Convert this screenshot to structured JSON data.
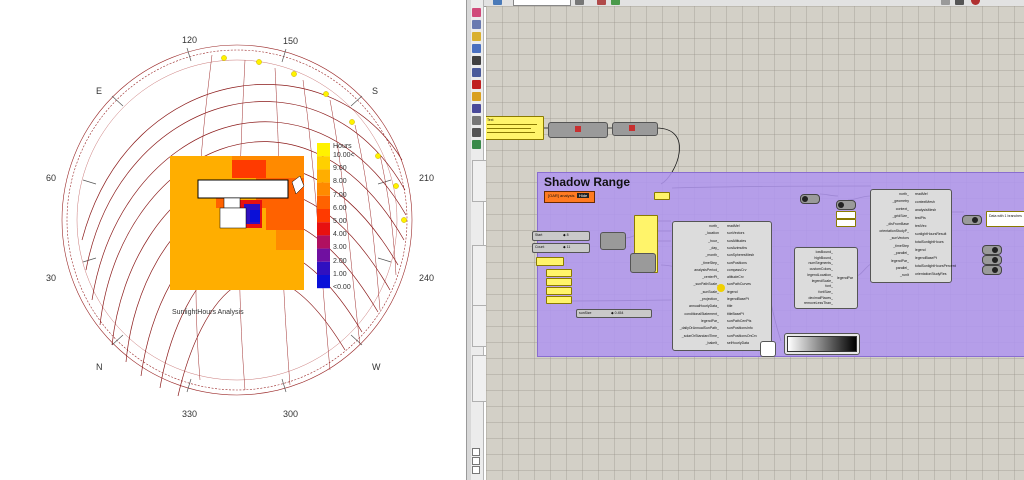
{
  "viewport": {
    "compass": {
      "e": "E",
      "s": "S",
      "n": "N",
      "w": "W",
      "deg_120": "120",
      "deg_150": "150",
      "deg_60": "60",
      "deg_210": "210",
      "deg_30": "30",
      "deg_240": "240",
      "deg_330": "330",
      "deg_300": "300"
    },
    "legend": {
      "title": "Hours",
      "labels": [
        "10.00<",
        "9.00",
        "8.00",
        "7.00",
        "6.00",
        "5.00",
        "4.00",
        "3.00",
        "2.00",
        "1.00",
        "<0.00"
      ],
      "colors": [
        "#fff200",
        "#ffd000",
        "#ffae00",
        "#ff8a00",
        "#ff6200",
        "#ff3a00",
        "#e81010",
        "#b01060",
        "#7010a0",
        "#3010c0",
        "#0a10d8"
      ]
    },
    "analysis_caption": "SunlightHours Analysis"
  },
  "grasshopper": {
    "group": {
      "title": "Shadow Range",
      "badge": "[OAR] analysis",
      "badge_button": "Hide"
    },
    "sliders": [
      {
        "name": "Start",
        "value": "◆ 8"
      },
      {
        "name": "Count",
        "value": "◆ 11"
      },
      {
        "name": "sunSize",
        "value": "◆ 0.454"
      }
    ],
    "panel_texts": {
      "source": "Text",
      "output": "Data with 1 branches"
    },
    "main_component": {
      "inputs": [
        "north_",
        "_location",
        "_hour_",
        "_day_",
        "_month_",
        "_timeStep_",
        "analysisPeriod_",
        "_centerPt_",
        "_sunPathScale_",
        "_sunScale_",
        "_projection_",
        "annualHourlyData_",
        "conditionalStatement_",
        "legendPar_",
        "_dailyOrAnnualSunPath_",
        "_solarOrStandardTime_",
        "_bakeIt_"
      ],
      "outputs": [
        "readMe!",
        "sunVectors",
        "sunAltitudes",
        "sunAzimuths",
        "sunSpheresMesh",
        "sunPositions",
        "compassCrv",
        "altitudeCrv",
        "sunPathCurves",
        "legend",
        "legendBasePt",
        "title",
        "titleBasePt",
        "sunPathCenPts",
        "sunPositionsInfo",
        "sunPositionsOnCrv",
        "selHourlyData"
      ]
    },
    "sunlight_component": {
      "inputs": [
        "north_",
        "_geometry",
        "context_",
        "_gridSize_",
        "_disFromBase",
        "orientationStudyP_",
        "_sunVectors",
        "_timeStep",
        "_parallel_",
        "legendPar_",
        "parallel_",
        "_runIt"
      ],
      "outputs": [
        "readMe!",
        "contextMesh",
        "analysisMesh",
        "testPts",
        "testVec",
        "sunlightHoursResult",
        "totalSunlightHours",
        "legend",
        "legendBasePt",
        "totalSunlightHoursPercent",
        "orientationStudyRes"
      ]
    },
    "legend_component": {
      "inputs": [
        "lowBound_",
        "highBound_",
        "numSegments_",
        "customColors_",
        "legendLocation_",
        "legendScale_",
        "font_",
        "fontSize_",
        "decimalPlaces_",
        "removeLessThan_"
      ],
      "output": "legendPar"
    }
  }
}
